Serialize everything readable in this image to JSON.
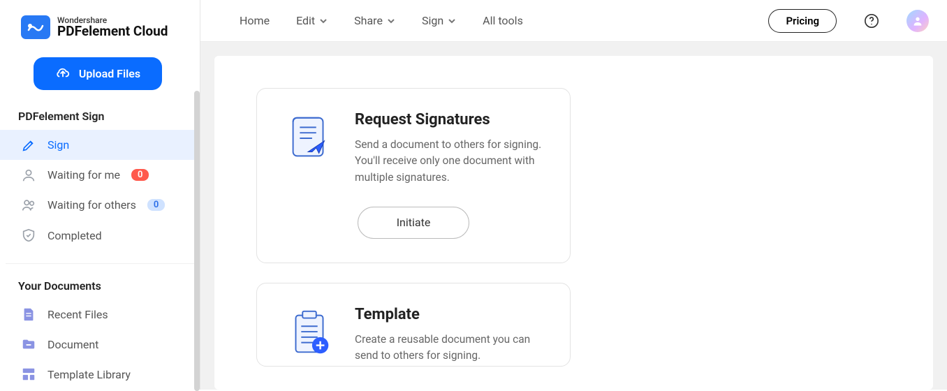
{
  "logo": {
    "sup": "Wondershare",
    "main": "PDFelement Cloud"
  },
  "upload_label": "Upload Files",
  "sections": {
    "sign_header": "PDFelement Sign",
    "docs_header": "Your Documents"
  },
  "nav": {
    "sign": "Sign",
    "waiting_me": "Waiting for me",
    "waiting_me_badge": "0",
    "waiting_others": "Waiting for others",
    "waiting_others_badge": "0",
    "completed": "Completed",
    "recent": "Recent Files",
    "document": "Document",
    "template_lib": "Template Library"
  },
  "topbar": {
    "home": "Home",
    "edit": "Edit",
    "share": "Share",
    "sign": "Sign",
    "all_tools": "All tools",
    "pricing": "Pricing"
  },
  "cards": {
    "request": {
      "title": "Request Signatures",
      "desc": "Send a document to others for signing. You'll receive only one document with multiple signatures.",
      "action": "Initiate"
    },
    "template": {
      "title": "Template",
      "desc": "Create a reusable document you can send to others for signing."
    }
  }
}
